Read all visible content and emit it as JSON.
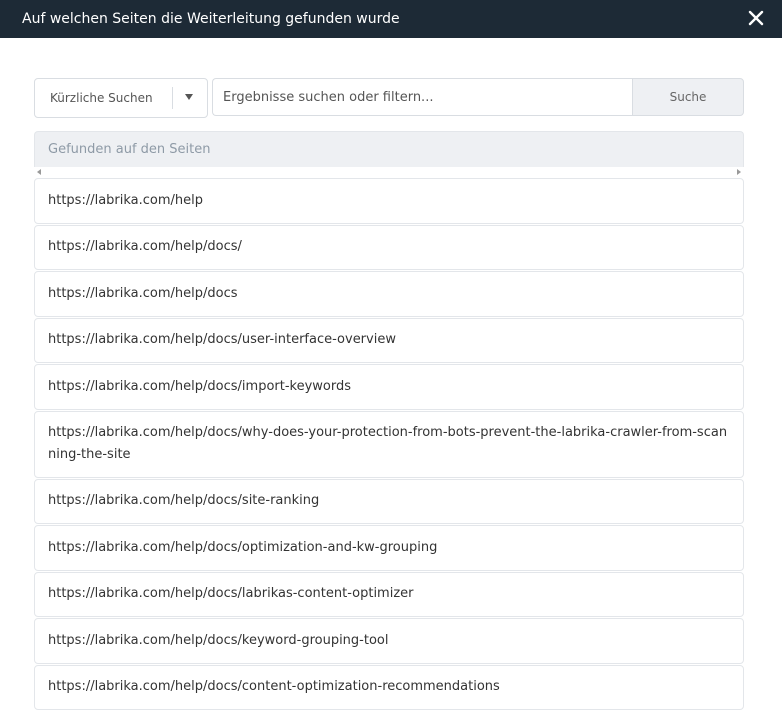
{
  "modal": {
    "title": "Auf welchen Seiten die Weiterleitung gefunden wurde",
    "close_icon": "close-icon"
  },
  "search": {
    "recent_label": "Kürzliche Suchen",
    "placeholder": "Ergebnisse suchen oder filtern...",
    "button_label": "Suche"
  },
  "table": {
    "header": "Gefunden auf den Seiten",
    "rows": [
      "https://labrika.com/help",
      "https://labrika.com/help/docs/",
      "https://labrika.com/help/docs",
      "https://labrika.com/help/docs/user-interface-overview",
      "https://labrika.com/help/docs/import-keywords",
      "https://labrika.com/help/docs/why-does-your-protection-from-bots-prevent-the-labrika-crawler-from-scanning-the-site",
      "https://labrika.com/help/docs/site-ranking",
      "https://labrika.com/help/docs/optimization-and-kw-grouping",
      "https://labrika.com/help/docs/labrikas-content-optimizer",
      "https://labrika.com/help/docs/keyword-grouping-tool",
      "https://labrika.com/help/docs/content-optimization-recommendations"
    ]
  }
}
